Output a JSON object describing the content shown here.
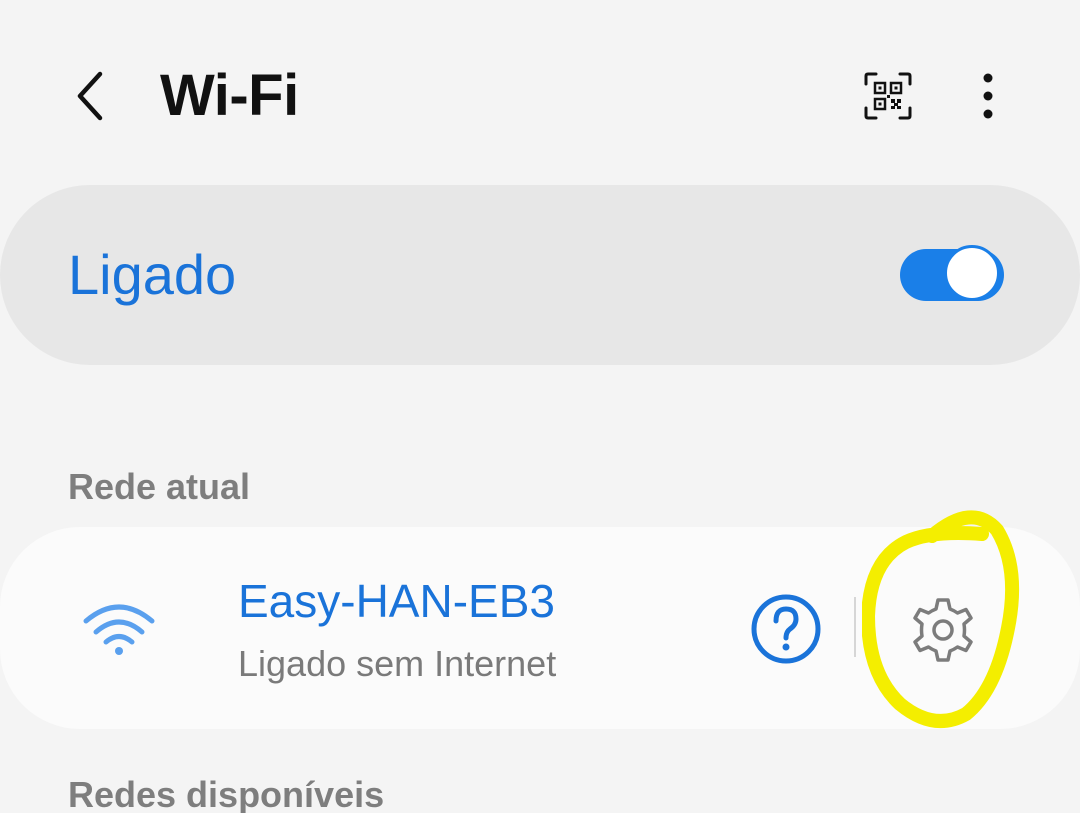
{
  "header": {
    "title": "Wi-Fi",
    "back_icon": "chevron-left-icon",
    "qr_icon": "qr-code-scan-icon",
    "more_icon": "more-vertical-icon"
  },
  "master_switch": {
    "label": "Ligado",
    "enabled": true,
    "accent_color": "#1a7fe8"
  },
  "current_network": {
    "heading": "Rede atual",
    "name": "Easy-HAN-EB3",
    "status": "Ligado sem Internet",
    "signal_icon": "wifi-signal-icon",
    "help_icon": "question-circle-icon",
    "settings_icon": "gear-icon"
  },
  "available_networks": {
    "heading": "Redes disponíveis"
  },
  "annotation": {
    "color": "#f4ee00",
    "target": "gear-icon"
  },
  "colors": {
    "background": "#f4f4f4",
    "accent": "#1a73d9",
    "secondary_text": "#7a7a7a"
  }
}
